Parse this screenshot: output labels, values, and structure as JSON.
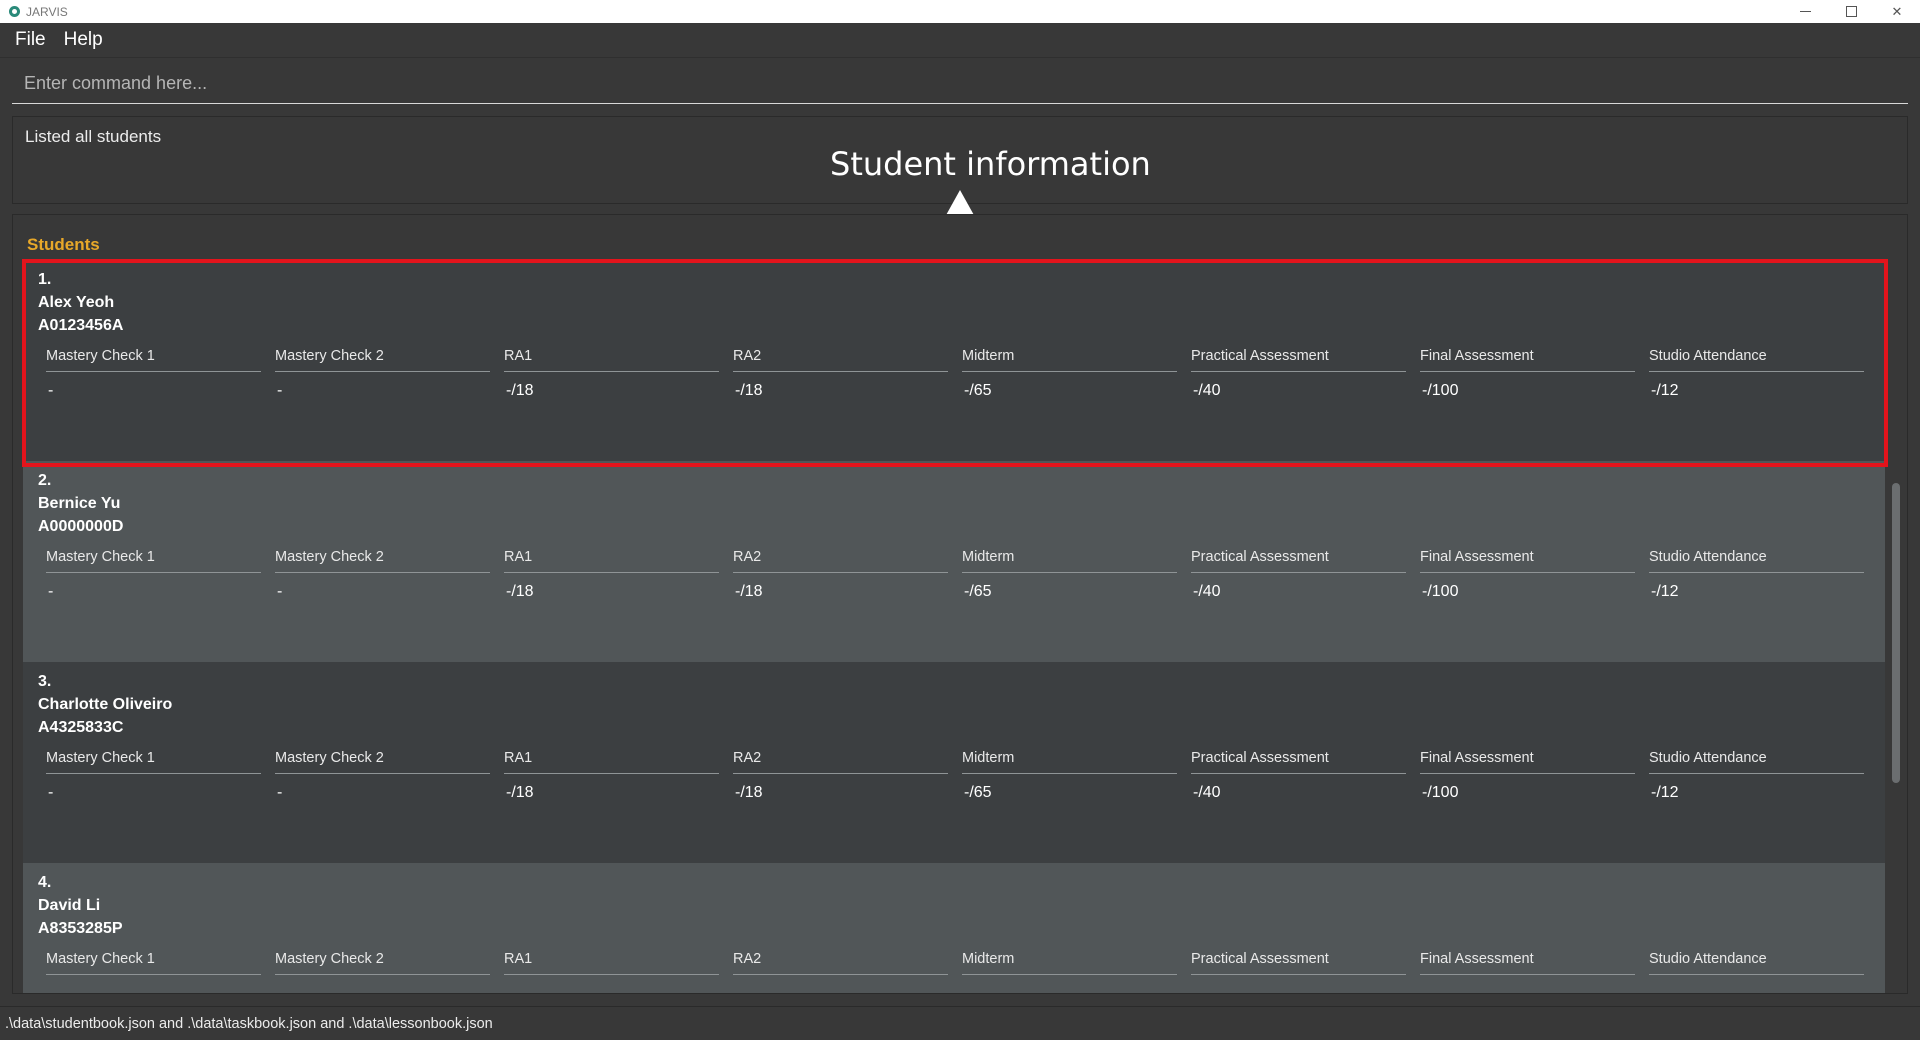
{
  "window": {
    "title": "JARVIS"
  },
  "menu": {
    "file": "File",
    "help": "Help"
  },
  "command": {
    "placeholder": "Enter command here..."
  },
  "result": {
    "text": "Listed all students"
  },
  "annotation": {
    "label": "Student information"
  },
  "students_panel": {
    "title": "Students"
  },
  "grade_headers": [
    "Mastery Check 1",
    "Mastery Check 2",
    "RA1",
    "RA2",
    "Midterm",
    "Practical Assessment",
    "Final Assessment",
    "Studio Attendance"
  ],
  "students": [
    {
      "index": "1.",
      "name": "Alex Yeoh",
      "id": "A0123456A",
      "values": [
        "-",
        "-",
        "-/18",
        "-/18",
        "-/65",
        "-/40",
        "-/100",
        "-/12"
      ]
    },
    {
      "index": "2.",
      "name": "Bernice Yu",
      "id": "A0000000D",
      "values": [
        "-",
        "-",
        "-/18",
        "-/18",
        "-/65",
        "-/40",
        "-/100",
        "-/12"
      ]
    },
    {
      "index": "3.",
      "name": "Charlotte Oliveiro",
      "id": "A4325833C",
      "values": [
        "-",
        "-",
        "-/18",
        "-/18",
        "-/65",
        "-/40",
        "-/100",
        "-/12"
      ]
    },
    {
      "index": "4.",
      "name": "David Li",
      "id": "A8353285P",
      "values": []
    }
  ],
  "status": {
    "text": ".\\data\\studentbook.json and .\\data\\taskbook.json and .\\data\\lessonbook.json"
  },
  "colors": {
    "highlight": "#e3141c",
    "section_title": "#e8a829"
  }
}
